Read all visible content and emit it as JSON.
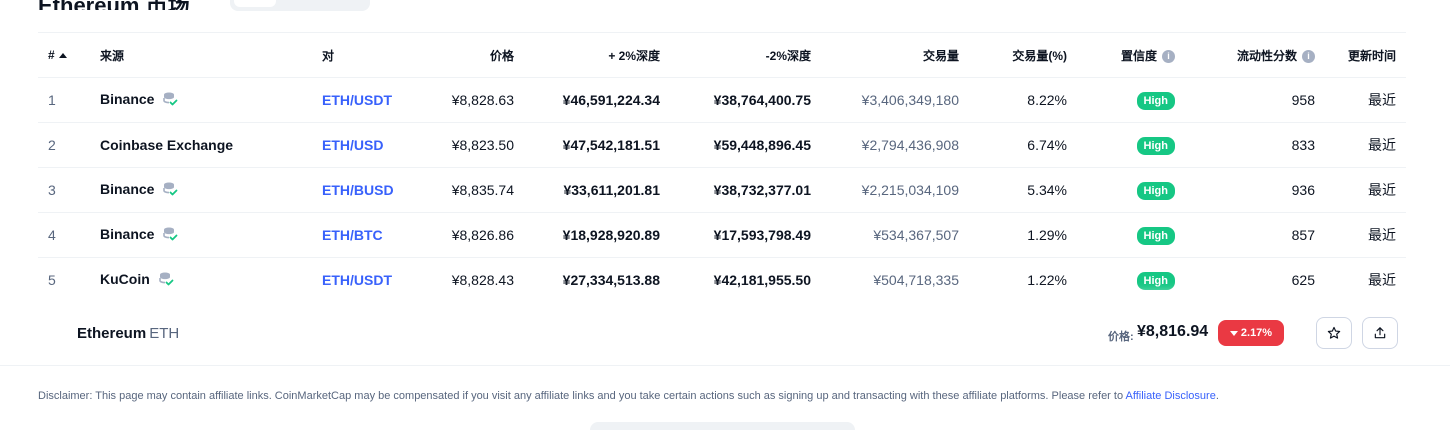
{
  "page": {
    "title": "Ethereum 市场"
  },
  "table": {
    "headers": {
      "rank": "#",
      "source": "来源",
      "pair": "对",
      "price": "价格",
      "depth_plus": "+ 2%深度",
      "depth_minus": "-2%深度",
      "volume": "交易量",
      "volume_pct": "交易量(%)",
      "confidence": "置信度",
      "liquidity": "流动性分数",
      "updated": "更新时间"
    },
    "rows": [
      {
        "rank": "1",
        "source": "Binance",
        "verified": true,
        "pair": "ETH/USDT",
        "price": "¥8,828.63",
        "depth_plus": "¥46,591,224.34",
        "depth_minus": "¥38,764,400.75",
        "volume": "¥3,406,349,180",
        "volume_pct": "8.22%",
        "confidence": "High",
        "liquidity": "958",
        "updated": "最近"
      },
      {
        "rank": "2",
        "source": "Coinbase Exchange",
        "verified": false,
        "pair": "ETH/USD",
        "price": "¥8,823.50",
        "depth_plus": "¥47,542,181.51",
        "depth_minus": "¥59,448,896.45",
        "volume": "¥2,794,436,908",
        "volume_pct": "6.74%",
        "confidence": "High",
        "liquidity": "833",
        "updated": "最近"
      },
      {
        "rank": "3",
        "source": "Binance",
        "verified": true,
        "pair": "ETH/BUSD",
        "price": "¥8,835.74",
        "depth_plus": "¥33,611,201.81",
        "depth_minus": "¥38,732,377.01",
        "volume": "¥2,215,034,109",
        "volume_pct": "5.34%",
        "confidence": "High",
        "liquidity": "936",
        "updated": "最近"
      },
      {
        "rank": "4",
        "source": "Binance",
        "verified": true,
        "pair": "ETH/BTC",
        "price": "¥8,826.86",
        "depth_plus": "¥18,928,920.89",
        "depth_minus": "¥17,593,798.49",
        "volume": "¥534,367,507",
        "volume_pct": "1.29%",
        "confidence": "High",
        "liquidity": "857",
        "updated": "最近"
      },
      {
        "rank": "5",
        "source": "KuCoin",
        "verified": true,
        "pair": "ETH/USDT",
        "price": "¥8,828.43",
        "depth_plus": "¥27,334,513.88",
        "depth_minus": "¥42,181,955.50",
        "volume": "¥504,718,335",
        "volume_pct": "1.22%",
        "confidence": "High",
        "liquidity": "625",
        "updated": "最近"
      }
    ]
  },
  "sticky": {
    "coin_name": "Ethereum",
    "coin_symbol": "ETH",
    "price_label": "价格:",
    "price": "¥8,816.94",
    "change": "2.17%",
    "change_direction": "down",
    "change_color": "#ea3943"
  },
  "disclaimer": {
    "text": "Disclaimer: This page may contain affiliate links. CoinMarketCap may be compensated if you visit any affiliate links and you take certain actions such as signing up and transacting with these affiliate platforms. Please refer to ",
    "link": "Affiliate Disclosure",
    "end": "."
  },
  "colors": {
    "accent": "#3861fb",
    "high_badge": "#16c784",
    "negative": "#ea3943"
  }
}
